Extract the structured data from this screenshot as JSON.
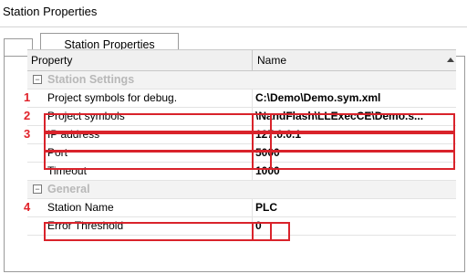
{
  "window": {
    "title": "Station Properties"
  },
  "tabs": [
    {
      "label": "Station Properties"
    }
  ],
  "grid": {
    "headers": {
      "property": "Property",
      "name": "Name"
    },
    "sections": [
      {
        "title": "Station Settings",
        "rows": [
          {
            "name": "Project symbols for debug.",
            "value": "C:\\Demo\\Demo.sym.xml",
            "marker": "1"
          },
          {
            "name": "Project symbols",
            "value": "\\NandFlash\\LLExecCE\\Demo.s...",
            "marker": "2"
          },
          {
            "name": "IP address",
            "value": "127.0.0.1",
            "marker": "3"
          },
          {
            "name": "Port",
            "value": "5000"
          },
          {
            "name": "Timeout",
            "value": "1000"
          }
        ]
      },
      {
        "title": "General",
        "rows": [
          {
            "name": "Station Name",
            "value": "PLC",
            "marker": "4"
          },
          {
            "name": "Error Threshold",
            "value": "0"
          }
        ]
      }
    ]
  },
  "colors": {
    "highlight": "#d9232b",
    "marker_number": "#e0232b"
  }
}
